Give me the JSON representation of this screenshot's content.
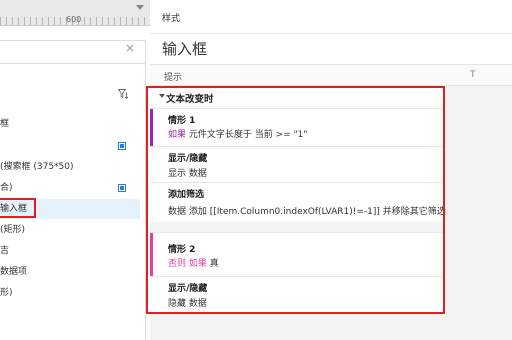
{
  "ruler": {
    "mark": "600"
  },
  "outline": {
    "close_label": "×",
    "rows": [
      {
        "text": "框",
        "checkbox": false
      },
      {
        "text": "",
        "checkbox": true
      },
      {
        "text": "(搜索框 (375*50)",
        "checkbox": false
      },
      {
        "text": "合)",
        "checkbox": true
      },
      {
        "text": "输入框",
        "checkbox": false,
        "selected": true
      },
      {
        "text": "(矩形)",
        "checkbox": false
      },
      {
        "text": "吉",
        "checkbox": false
      },
      {
        "text": "数据项",
        "checkbox": false
      },
      {
        "text": "形)",
        "checkbox": false
      }
    ]
  },
  "panel": {
    "header": "样式",
    "element_name": "输入框",
    "tip_label": "提示",
    "tip_type_icon": "T"
  },
  "events": {
    "title": "文本改变时",
    "cases": [
      {
        "name": "情形 1",
        "condition_kw": "如果",
        "condition_text": " 元件文字长度于 当前 >= \"1\"",
        "bar_color": "#9c27b0",
        "actions": [
          {
            "title": "显示/隐藏",
            "desc": "显示 数据"
          },
          {
            "title": "添加筛选",
            "desc": "数据 添加 [[Item.Column0.indexOf(LVAR1)!=-1]] 并移除其它筛选"
          }
        ]
      },
      {
        "name": "情形 2",
        "condition_kw": "否则 如果",
        "condition_text": " 真",
        "bar_color": "#e040a0",
        "actions": [
          {
            "title": "显示/隐藏",
            "desc": "隐藏 数据"
          }
        ]
      }
    ]
  },
  "colors": {
    "highlight": "#e0201f",
    "keyword": "#9c27b0",
    "selection": "#e5f2fb"
  }
}
